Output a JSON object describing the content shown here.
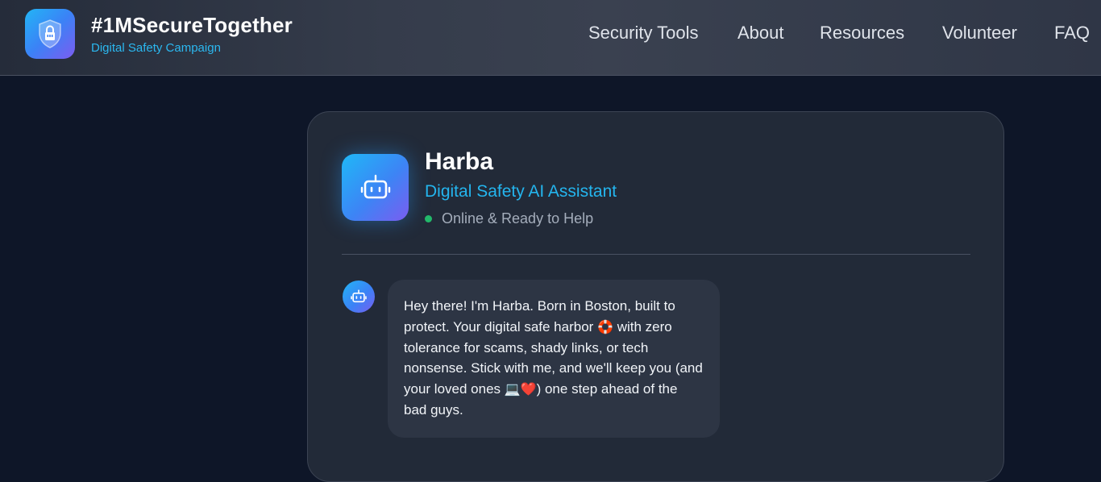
{
  "header": {
    "title": "#1MSecureTogether",
    "subtitle": "Digital Safety Campaign",
    "logo_icon": "shield-lock-icon",
    "nav": [
      {
        "label": "Security Tools"
      },
      {
        "label": "About"
      },
      {
        "label": "Resources"
      },
      {
        "label": "Volunteer"
      },
      {
        "label": "FAQ"
      }
    ]
  },
  "assistant": {
    "name": "Harba",
    "role": "Digital Safety AI Assistant",
    "status": "Online & Ready to Help",
    "avatar_icon": "robot-icon"
  },
  "messages": [
    {
      "sender": "bot",
      "avatar_icon": "robot-icon",
      "text_before_buoy": "Hey there! I'm Harba. Born in Boston, built to protect. Your digital safe harbor ",
      "buoy_emoji": "🛟",
      "text_before_devices": " with zero tolerance for scams, shady links, or tech nonsense. Stick with me, and we'll keep you (and your loved ones ",
      "devices_emoji": "💻❤️",
      "text_after": ") one step ahead of the bad guys."
    }
  ],
  "colors": {
    "accent": "#24b5ee",
    "online": "#22b86a",
    "background": "#0e1628",
    "card": "#222a38",
    "bubble": "#2d3544"
  }
}
